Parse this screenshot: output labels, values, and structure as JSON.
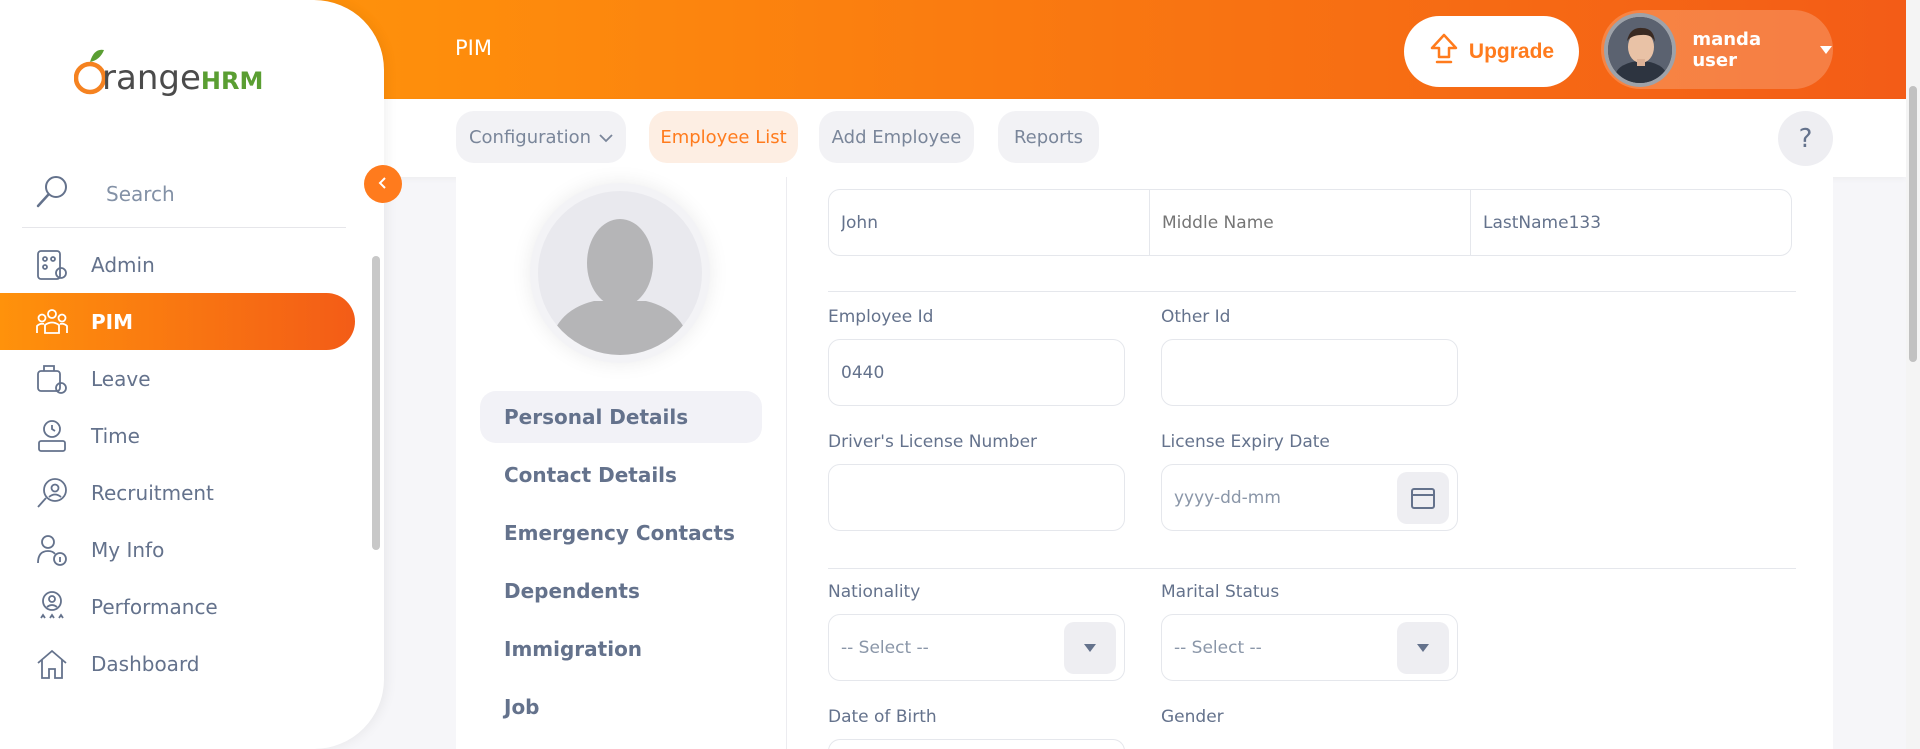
{
  "header": {
    "module_title": "PIM",
    "upgrade_label": "Upgrade",
    "user_name": "manda user"
  },
  "subnav": {
    "items": [
      {
        "label": "Configuration",
        "has_dropdown": true,
        "active": false
      },
      {
        "label": "Employee List",
        "active": true
      },
      {
        "label": "Add Employee",
        "active": false
      },
      {
        "label": "Reports",
        "active": false
      }
    ],
    "help_label": "?"
  },
  "sidebar": {
    "logo": {
      "brand_a": "range",
      "brand_b": "HRM"
    },
    "search_label": "Search",
    "items": [
      {
        "label": "Admin",
        "icon": "admin-icon"
      },
      {
        "label": "PIM",
        "icon": "pim-icon",
        "active": true
      },
      {
        "label": "Leave",
        "icon": "leave-icon"
      },
      {
        "label": "Time",
        "icon": "time-icon"
      },
      {
        "label": "Recruitment",
        "icon": "recruitment-icon"
      },
      {
        "label": "My Info",
        "icon": "my-info-icon"
      },
      {
        "label": "Performance",
        "icon": "performance-icon"
      },
      {
        "label": "Dashboard",
        "icon": "dashboard-icon"
      }
    ]
  },
  "profile_tabs": [
    {
      "label": "Personal Details",
      "active": true
    },
    {
      "label": "Contact Details"
    },
    {
      "label": "Emergency Contacts"
    },
    {
      "label": "Dependents"
    },
    {
      "label": "Immigration"
    },
    {
      "label": "Job"
    }
  ],
  "form": {
    "first_name": "John",
    "middle_name_placeholder": "Middle Name",
    "last_name": "LastName133",
    "employee_id_label": "Employee Id",
    "employee_id": "0440",
    "other_id_label": "Other Id",
    "other_id": "",
    "license_label": "Driver's License Number",
    "license": "",
    "license_expiry_label": "License Expiry Date",
    "license_expiry_placeholder": "yyyy-dd-mm",
    "nationality_label": "Nationality",
    "nationality_value": "-- Select --",
    "marital_label": "Marital Status",
    "marital_value": "-- Select --",
    "dob_label": "Date of Birth",
    "gender_label": "Gender"
  },
  "colors": {
    "accent": "#ff7b1d",
    "accent_gradient_start": "#ff920b",
    "accent_gradient_end": "#f35c17",
    "text": "#64728c"
  }
}
